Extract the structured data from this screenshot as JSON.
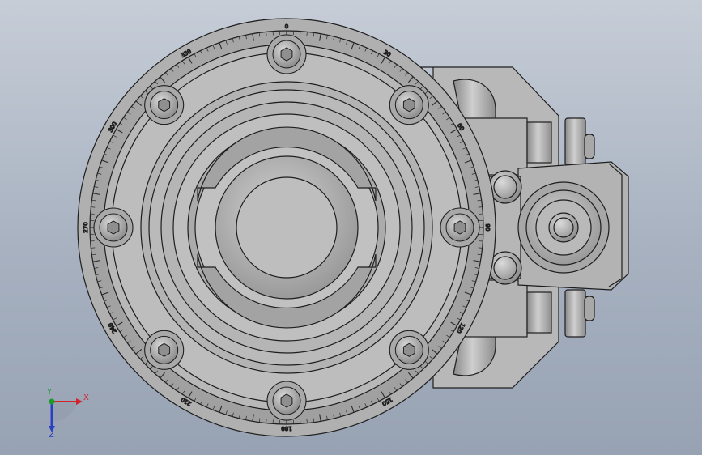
{
  "model_view": {
    "part": "rotary-table-assembly",
    "view": "top"
  },
  "dial": {
    "scale_labels": [
      "0",
      "30",
      "60",
      "90",
      "120",
      "150",
      "180",
      "210",
      "240",
      "270",
      "300",
      "330"
    ]
  },
  "triad": {
    "x_label": "X",
    "y_label": "Y",
    "z_label": "Z",
    "x_color": "#d3232a",
    "y_color": "#1c9a2c",
    "z_color": "#2a3fc2"
  },
  "colors": {
    "background_top": "#c6cdd7",
    "background_bottom": "#97a2b3",
    "metal_light": "#c2c2c2",
    "metal_mid": "#a9a9a9",
    "metal_dark": "#8c8c8c",
    "edge": "#1e1e1e"
  }
}
